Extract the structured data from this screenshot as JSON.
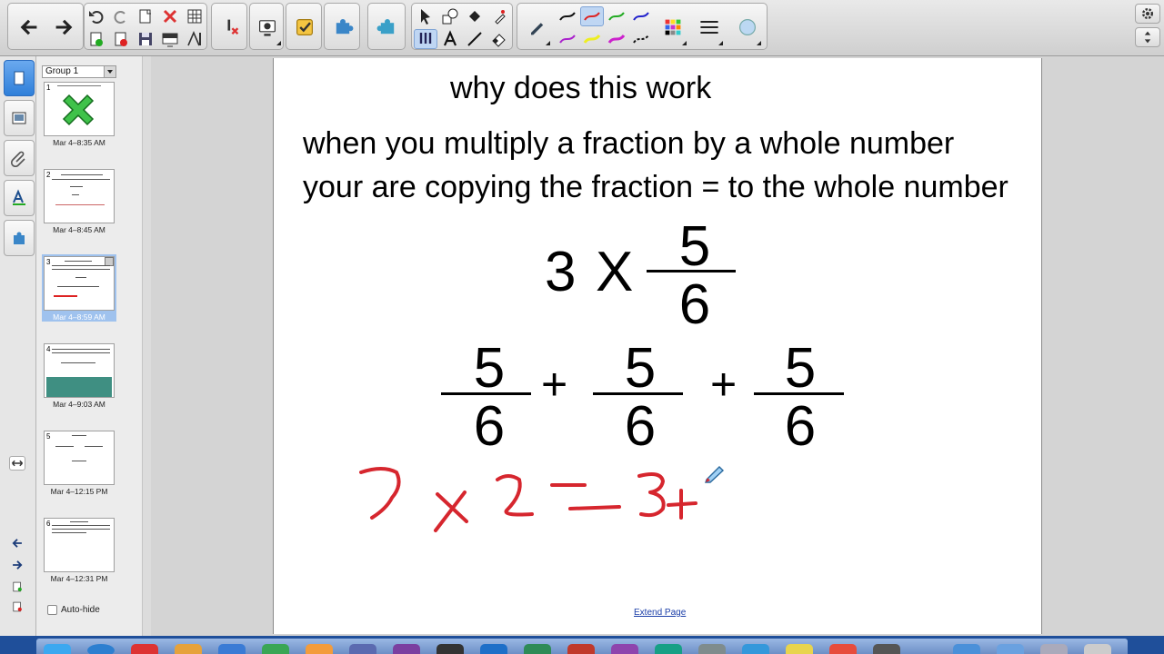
{
  "toolbar": {
    "groups": [
      {
        "name": "navigation",
        "buttons": [
          "back-arrow-icon",
          "forward-arrow-icon"
        ]
      },
      {
        "name": "edit",
        "buttons": [
          "undo-icon",
          "redo-icon",
          "new-page-icon",
          "delete-icon",
          "table-icon",
          "add-page-icon",
          "delete-page-icon",
          "save-icon",
          "screen-shade-icon",
          "measurement-tools-icon"
        ]
      },
      {
        "name": "clear",
        "buttons": [
          "clear-ink-icon"
        ]
      },
      {
        "name": "document-camera",
        "buttons": [
          "document-camera-icon"
        ]
      },
      {
        "name": "response",
        "buttons": [
          "response-icon"
        ]
      },
      {
        "name": "addon",
        "buttons": [
          "addon-icon"
        ]
      },
      {
        "name": "lesson",
        "buttons": [
          "lesson-activity-icon"
        ]
      },
      {
        "name": "tools",
        "buttons": [
          "select-icon",
          "shapes-icon",
          "fill-icon",
          "magic-pen-icon",
          "pen-icon",
          "text-icon",
          "line-icon",
          "eraser-icon"
        ]
      },
      {
        "name": "pens",
        "buttons": [
          "pen-dark-icon",
          "pen-red-icon",
          "pen-blue-icon",
          "pen-green-icon",
          "pen-purple-icon",
          "pen-magenta-icon",
          "pen-yellow-icon",
          "pen-pink-icon",
          "pen-black-icon",
          "color-palette-icon",
          "line-style-icon",
          "transparency-icon"
        ]
      }
    ],
    "right": [
      "settings-gear-icon",
      "toolbar-move-icon"
    ]
  },
  "sidebar": {
    "tabs": [
      "page-sorter-icon",
      "gallery-icon",
      "attachments-icon",
      "properties-icon",
      "addons-icon"
    ],
    "group_label": "Group 1",
    "pages": [
      {
        "num": "1",
        "title": "Multiplying fractions by whole numbers",
        "time": "Mar 4–8:35 AM"
      },
      {
        "num": "2",
        "title": "When multiplying fractions",
        "time": "Mar 4–8:45 AM"
      },
      {
        "num": "3",
        "title": "why does this work",
        "time": "Mar 4–8:59 AM"
      },
      {
        "num": "4",
        "title": "If you are working with fractions you should",
        "time": "Mar 4–9:03 AM"
      },
      {
        "num": "5",
        "title": "practice",
        "time": "Mar 4–12:15 PM"
      },
      {
        "num": "6",
        "title": "Practice",
        "time": "Mar 4–12:31 PM"
      }
    ],
    "autohide_label": "Auto-hide"
  },
  "slide": {
    "title": "why does this work",
    "body": "when you multiply a fraction by a whole number your are copying the fraction = to the whole number",
    "expression": {
      "whole": "3",
      "times": "X",
      "numerator": "5",
      "denominator": "6"
    },
    "sum": [
      {
        "numerator": "5",
        "denominator": "6"
      },
      {
        "numerator": "5",
        "denominator": "6"
      },
      {
        "numerator": "5",
        "denominator": "6"
      }
    ],
    "plus": "+",
    "extend_link": "Extend Page"
  },
  "colors": {
    "ink_red": "#d6262e",
    "selection_blue": "#9fc2ee",
    "accent_tab": "#2f7fd9"
  }
}
